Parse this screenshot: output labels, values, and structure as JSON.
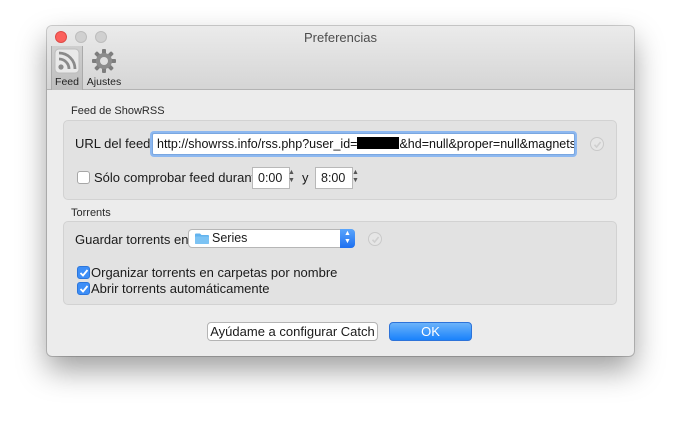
{
  "window": {
    "title": "Preferencias"
  },
  "toolbar": {
    "feed_label": "Feed",
    "ajustes_label": "Ajustes"
  },
  "feed_section": {
    "title": "Feed de ShowRSS",
    "url_label": "URL del feed:",
    "url_value_prefix": "http://showrss.info/rss.php?user_id=",
    "url_value_suffix": "&hd=null&proper=null&magnets=false",
    "check_label": "Sólo comprobar feed durante",
    "check_checked": false,
    "time_from": "0:00",
    "time_sep": "y",
    "time_to": "8:00"
  },
  "torrents_section": {
    "title": "Torrents",
    "save_label": "Guardar torrents en:",
    "save_folder": "Series",
    "organize_label": "Organizar torrents en carpetas por nombre",
    "organize_checked": true,
    "autoopen_label": "Abrir torrents automáticamente",
    "autoopen_checked": true
  },
  "buttons": {
    "help_label": "Ayúdame a configurar Catch",
    "ok_label": "OK"
  },
  "colors": {
    "accent": "#1a82fb",
    "close": "#fc605c",
    "folder": "#62b3ee"
  }
}
